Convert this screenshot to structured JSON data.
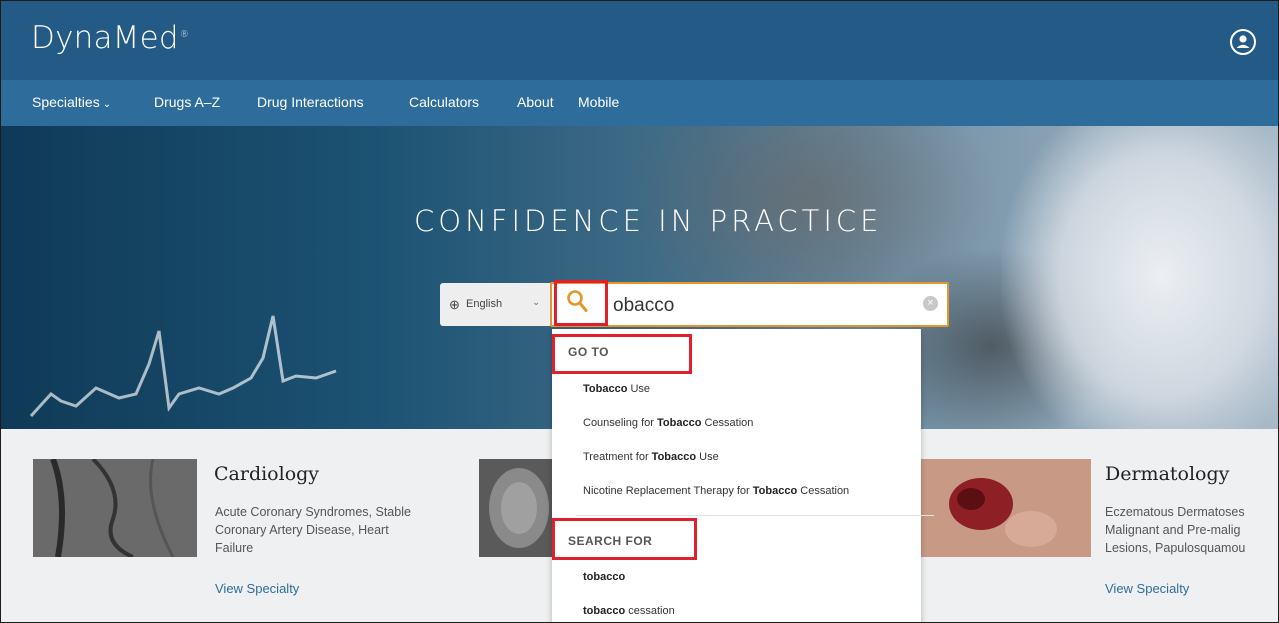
{
  "app": {
    "logo": "DynaMed"
  },
  "nav": {
    "specialties": "Specialties",
    "drugs": "Drugs A–Z",
    "interactions": "Drug Interactions",
    "calculators": "Calculators",
    "about": "About",
    "mobile": "Mobile"
  },
  "hero": {
    "tagline": "CONFIDENCE IN PRACTICE"
  },
  "search": {
    "language": "English",
    "value": "obacco"
  },
  "dropdown": {
    "goto_header": "GO TO",
    "goto_items": [
      {
        "pre": "",
        "bold": "Tobacco",
        "post": " Use"
      },
      {
        "pre": "Counseling for ",
        "bold": "Tobacco",
        "post": " Cessation"
      },
      {
        "pre": "Treatment for ",
        "bold": "Tobacco",
        "post": " Use"
      },
      {
        "pre": "Nicotine Replacement Therapy for ",
        "bold": "Tobacco",
        "post": " Cessation"
      }
    ],
    "searchfor_header": "SEARCH FOR",
    "searchfor_items": [
      {
        "bold": "tobacco",
        "post": ""
      },
      {
        "bold": "tobacco",
        "post": " cessation"
      }
    ]
  },
  "cards": {
    "cardiology": {
      "title": "Cardiology",
      "desc1": "Acute Coronary Syndromes, Stable",
      "desc2": "Coronary Artery Disease, Heart",
      "desc3": "Failure",
      "link": "View Specialty"
    },
    "dermatology": {
      "title": "Dermatology",
      "desc1": "Eczematous Dermatoses",
      "desc2": "Malignant and Pre-malig",
      "desc3": "Lesions, Papulosquamou",
      "link": "View Specialty"
    }
  },
  "colors": {
    "header": "#245a86",
    "nav": "#2e6d9b",
    "search_accent": "#e6962e",
    "highlight_box": "#e0202a",
    "link": "#2e6d9b"
  },
  "icons": [
    "account-icon",
    "globe-icon",
    "chevron-down-icon",
    "search-icon",
    "clear-icon"
  ]
}
